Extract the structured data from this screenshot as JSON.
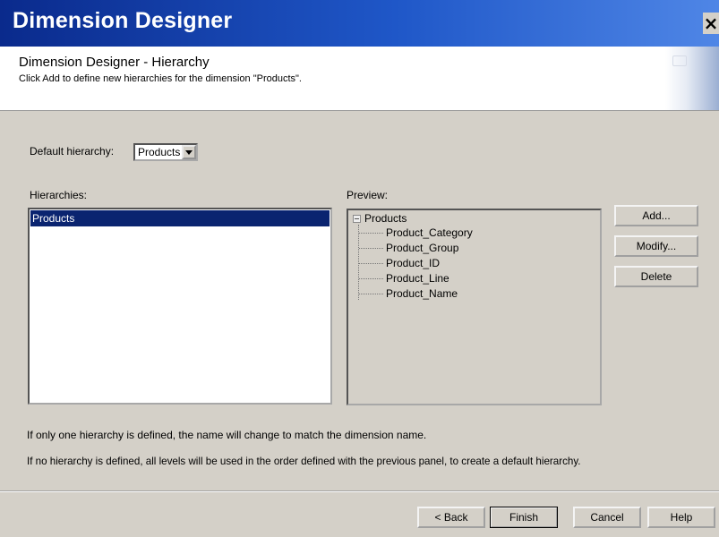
{
  "window": {
    "title": "Dimension Designer",
    "close_label": "×"
  },
  "header": {
    "title": "Dimension Designer - Hierarchy",
    "subtitle": "Click Add to define new hierarchies for the dimension \"Products\"."
  },
  "default_hierarchy": {
    "label": "Default hierarchy:",
    "value": "Products"
  },
  "hierarchies": {
    "label": "Hierarchies:",
    "items": [
      "Products"
    ],
    "selected": "Products"
  },
  "preview": {
    "label": "Preview:",
    "root": "Products",
    "children": [
      "Product_Category",
      "Product_Group",
      "Product_ID",
      "Product_Line",
      "Product_Name"
    ]
  },
  "side_buttons": {
    "add": "Add...",
    "modify": "Modify...",
    "delete": "Delete"
  },
  "notes": {
    "line1": "If only one hierarchy is defined, the name will change to match the dimension name.",
    "line2": "If no hierarchy is defined, all levels will be used in the order defined with the previous panel, to create a default hierarchy."
  },
  "footer": {
    "back": "< Back",
    "finish": "Finish",
    "cancel": "Cancel",
    "help": "Help"
  },
  "colors": {
    "titlebar": "#0a2a8c",
    "selection": "#0a2470",
    "dialog": "#d4d0c8"
  }
}
